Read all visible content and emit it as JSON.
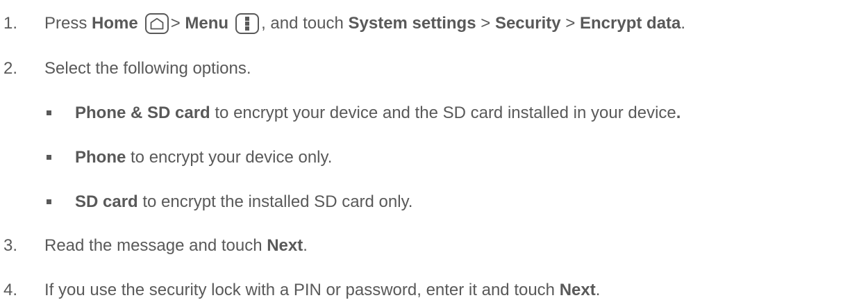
{
  "steps": [
    {
      "number": "1.",
      "parts": {
        "press": "Press ",
        "home": "Home",
        "gt1": "> ",
        "menu": "Menu",
        "touch": ", and touch ",
        "system_settings": "System settings",
        "gt2": " > ",
        "security": "Security",
        "gt3": " > ",
        "encrypt_data": "Encrypt data",
        "end": "."
      }
    },
    {
      "number": "2.",
      "text": "Select the following options."
    },
    {
      "number": "3.",
      "pre": "Read the message and touch ",
      "bold": "Next",
      "end": "."
    },
    {
      "number": "4.",
      "pre": "If you use the security lock with a PIN or password, enter it and touch ",
      "bold": "Next",
      "end": "."
    }
  ],
  "options": [
    {
      "bold": "Phone & SD card",
      "text": " to encrypt your device and the SD card installed in your device",
      "end": "."
    },
    {
      "bold": "Phone",
      "text": " to encrypt your device only."
    },
    {
      "bold": "SD card",
      "text": " to encrypt the installed SD card only."
    }
  ],
  "icons": {
    "home": "home-icon",
    "menu": "menu-icon"
  },
  "colors": {
    "text": "#595959",
    "background": "#ffffff"
  }
}
